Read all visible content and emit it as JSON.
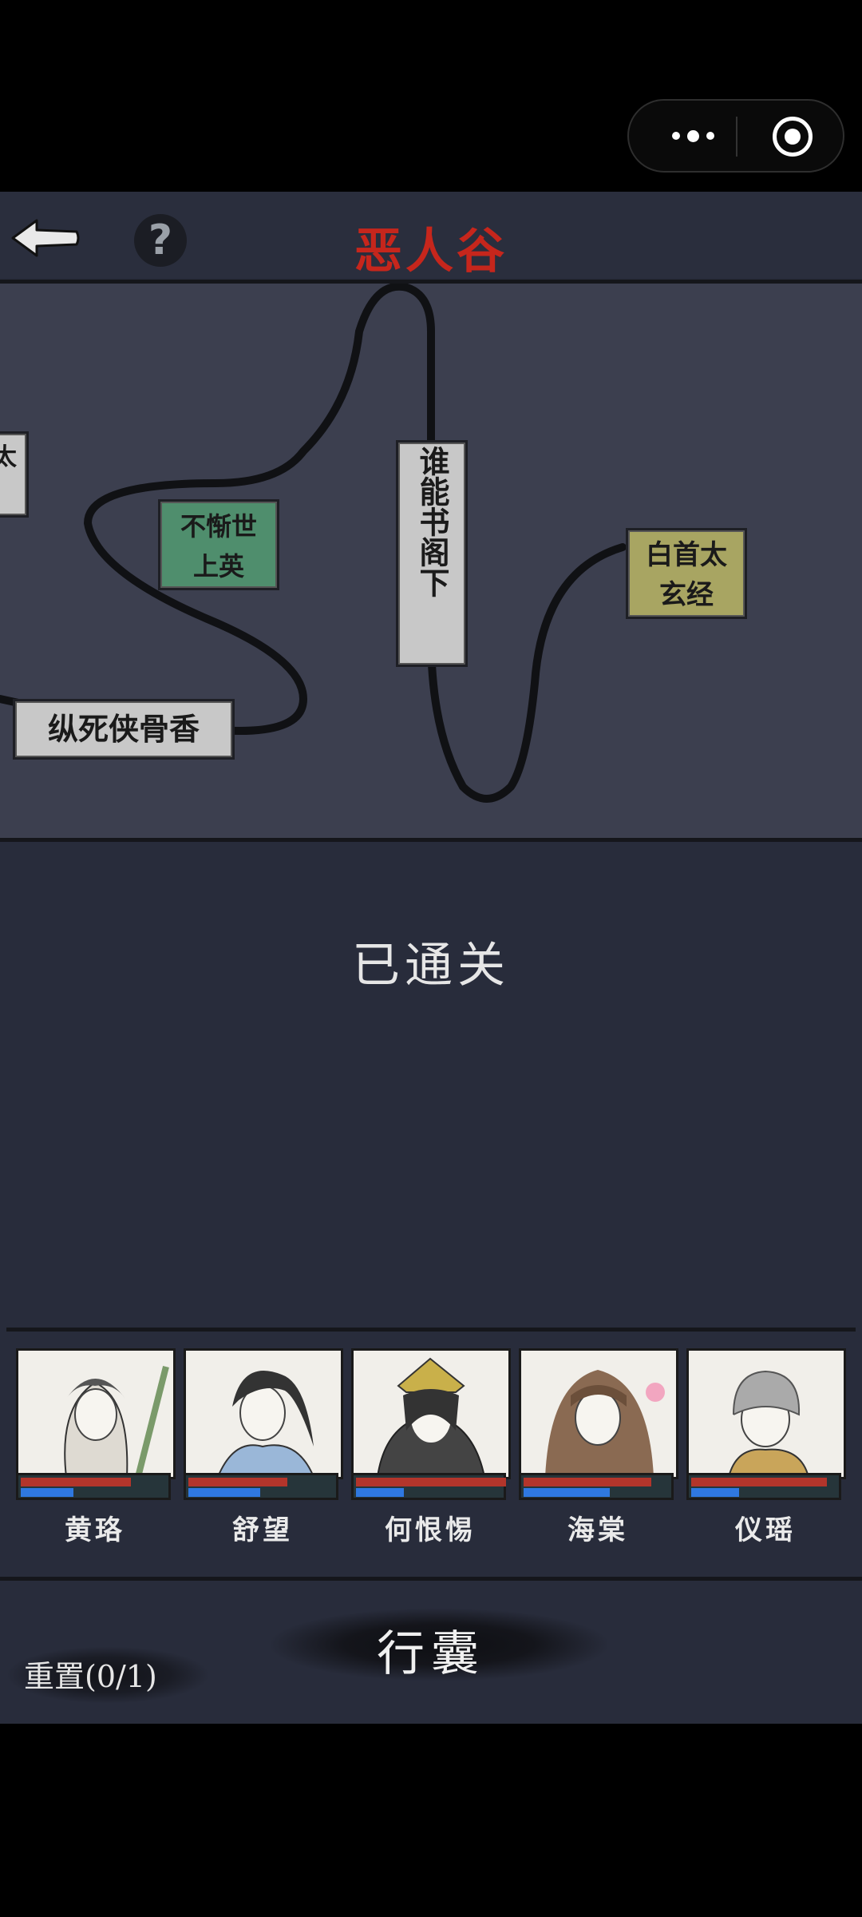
{
  "header": {
    "title": "恶人谷"
  },
  "map": {
    "nodes": [
      {
        "id": "partial",
        "label": "太"
      },
      {
        "id": "a",
        "label_line1": "不惭世",
        "label_line2": "上英"
      },
      {
        "id": "b",
        "label": "谁能书阁下"
      },
      {
        "id": "c",
        "label_line1": "白首太",
        "label_line2": "玄经"
      },
      {
        "id": "d",
        "label": "纵死侠骨香"
      }
    ]
  },
  "status_text": "已通关",
  "party": [
    {
      "name": "黄珞",
      "hp": 0.72,
      "mp": 0.35
    },
    {
      "name": "舒望",
      "hp": 0.65,
      "mp": 0.48
    },
    {
      "name": "何恨惕",
      "hp": 1.0,
      "mp": 0.32
    },
    {
      "name": "海棠",
      "hp": 0.85,
      "mp": 0.57
    },
    {
      "name": "仪瑶",
      "hp": 0.9,
      "mp": 0.32
    }
  ],
  "bag_label": "行囊",
  "reset_label": "重置(0/1)",
  "colors": {
    "title_red": "#c6261c",
    "hp_red": "#b3352b",
    "mp_blue": "#2f78e0",
    "node_green": "#4f8e6d",
    "node_grey": "#c8c8c8",
    "node_olive": "#a8a562"
  }
}
